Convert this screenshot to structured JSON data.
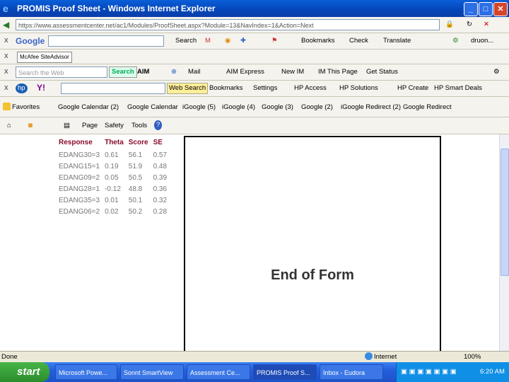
{
  "window": {
    "title": "PROMIS Proof Sheet - Windows Internet Explorer"
  },
  "address": {
    "url": "https://www.assessmentcenter.net/ac1/Modules/ProofSheet.aspx?Module=13&NavIndex=1&Action=Next"
  },
  "google_bar": {
    "logo": "Google",
    "search": "Search",
    "check": "Check",
    "translate": "Translate",
    "bookmarks": "Bookmarks",
    "user": "druon..."
  },
  "mcafee": {
    "label": "McAfee SiteAdvisor"
  },
  "aim_bar": {
    "placeholder": "Search the Web",
    "search_btn": "Search",
    "aim": "AIM",
    "mail": "Mail",
    "aim_express": "AIM Express",
    "new_im": "New IM",
    "im_this_page": "IM This Page",
    "get_status": "Get Status"
  },
  "hp_bar": {
    "web_search": "Web Search",
    "bookmarks": "Bookmarks",
    "settings": "Settings",
    "hp_access": "HP Access",
    "hp_solutions": "HP Solutions",
    "hp_create": "HP Create",
    "hp_smart_deals": "HP Smart Deals"
  },
  "favorites": {
    "label": "Favorites",
    "items": [
      "Google Calendar (2)",
      "Google Calendar",
      "iGoogle (5)",
      "iGoogle (4)",
      "Google (3)",
      "Google (2)",
      "iGoogle Redirect (2)",
      "Google Redirect"
    ]
  },
  "command_bar": {
    "page": "Page",
    "safety": "Safety",
    "tools": "Tools"
  },
  "results": {
    "headers": [
      "Response",
      "Theta",
      "Score",
      "SE"
    ],
    "rows": [
      [
        "EDANG30=3",
        "0.61",
        "56.1",
        "0.57"
      ],
      [
        "EDANG15=1",
        "0.19",
        "51.9",
        "0.48"
      ],
      [
        "EDANG09=2",
        "0.05",
        "50.5",
        "0.39"
      ],
      [
        "EDANG28=1",
        "-0.12",
        "48.8",
        "0.36"
      ],
      [
        "EDANG35=3",
        "0.01",
        "50.1",
        "0.32"
      ],
      [
        "EDANG06=2",
        "0.02",
        "50.2",
        "0.28"
      ]
    ]
  },
  "frame": {
    "text": "End of Form"
  },
  "status": {
    "left": "Done",
    "zone": "Internet",
    "zoom": "100%"
  },
  "taskbar": {
    "start": "start",
    "tasks": [
      "Microsoft Powe...",
      "Sonnt SmartView",
      "Assessment Ce...",
      "PROMIS Proof S...",
      "Inbox - Eudora"
    ],
    "clock": "6:20 AM"
  },
  "colors": {
    "title_blue": "#0545b8",
    "header_red": "#8b0a2a",
    "start_green": "#2c8c2c"
  }
}
